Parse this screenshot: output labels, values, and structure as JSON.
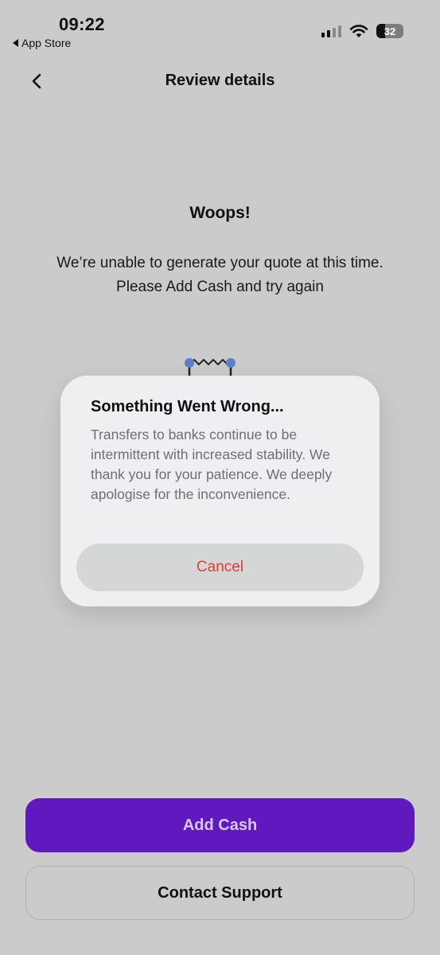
{
  "status_bar": {
    "time": "09:22",
    "back_app": "App Store",
    "battery": "32"
  },
  "header": {
    "title": "Review details"
  },
  "main": {
    "heading": "Woops!",
    "message_line1": "We’re unable to generate your quote at this time.",
    "message_line2": "Please Add Cash and try again"
  },
  "alert": {
    "title": "Something Went Wrong...",
    "body": "Transfers to banks continue to be intermittent with increased stability. We thank you for your patience. We deeply apologise for the inconvenience.",
    "cancel_label": "Cancel"
  },
  "actions": {
    "primary_label": "Add Cash",
    "secondary_label": "Contact Support"
  },
  "colors": {
    "background": "#cbcbcb",
    "primary": "#5f19bf",
    "destructive": "#e23b33",
    "illustration_accent": "#5b7fc9"
  }
}
